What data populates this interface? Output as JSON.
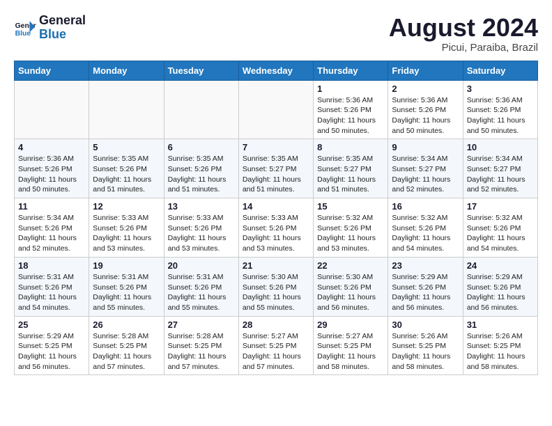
{
  "logo": {
    "line1": "General",
    "line2": "Blue"
  },
  "title": "August 2024",
  "subtitle": "Picui, Paraiba, Brazil",
  "weekdays": [
    "Sunday",
    "Monday",
    "Tuesday",
    "Wednesday",
    "Thursday",
    "Friday",
    "Saturday"
  ],
  "weeks": [
    [
      {
        "day": "",
        "info": ""
      },
      {
        "day": "",
        "info": ""
      },
      {
        "day": "",
        "info": ""
      },
      {
        "day": "",
        "info": ""
      },
      {
        "day": "1",
        "info": "Sunrise: 5:36 AM\nSunset: 5:26 PM\nDaylight: 11 hours\nand 50 minutes."
      },
      {
        "day": "2",
        "info": "Sunrise: 5:36 AM\nSunset: 5:26 PM\nDaylight: 11 hours\nand 50 minutes."
      },
      {
        "day": "3",
        "info": "Sunrise: 5:36 AM\nSunset: 5:26 PM\nDaylight: 11 hours\nand 50 minutes."
      }
    ],
    [
      {
        "day": "4",
        "info": "Sunrise: 5:36 AM\nSunset: 5:26 PM\nDaylight: 11 hours\nand 50 minutes."
      },
      {
        "day": "5",
        "info": "Sunrise: 5:35 AM\nSunset: 5:26 PM\nDaylight: 11 hours\nand 51 minutes."
      },
      {
        "day": "6",
        "info": "Sunrise: 5:35 AM\nSunset: 5:26 PM\nDaylight: 11 hours\nand 51 minutes."
      },
      {
        "day": "7",
        "info": "Sunrise: 5:35 AM\nSunset: 5:27 PM\nDaylight: 11 hours\nand 51 minutes."
      },
      {
        "day": "8",
        "info": "Sunrise: 5:35 AM\nSunset: 5:27 PM\nDaylight: 11 hours\nand 51 minutes."
      },
      {
        "day": "9",
        "info": "Sunrise: 5:34 AM\nSunset: 5:27 PM\nDaylight: 11 hours\nand 52 minutes."
      },
      {
        "day": "10",
        "info": "Sunrise: 5:34 AM\nSunset: 5:27 PM\nDaylight: 11 hours\nand 52 minutes."
      }
    ],
    [
      {
        "day": "11",
        "info": "Sunrise: 5:34 AM\nSunset: 5:26 PM\nDaylight: 11 hours\nand 52 minutes."
      },
      {
        "day": "12",
        "info": "Sunrise: 5:33 AM\nSunset: 5:26 PM\nDaylight: 11 hours\nand 53 minutes."
      },
      {
        "day": "13",
        "info": "Sunrise: 5:33 AM\nSunset: 5:26 PM\nDaylight: 11 hours\nand 53 minutes."
      },
      {
        "day": "14",
        "info": "Sunrise: 5:33 AM\nSunset: 5:26 PM\nDaylight: 11 hours\nand 53 minutes."
      },
      {
        "day": "15",
        "info": "Sunrise: 5:32 AM\nSunset: 5:26 PM\nDaylight: 11 hours\nand 53 minutes."
      },
      {
        "day": "16",
        "info": "Sunrise: 5:32 AM\nSunset: 5:26 PM\nDaylight: 11 hours\nand 54 minutes."
      },
      {
        "day": "17",
        "info": "Sunrise: 5:32 AM\nSunset: 5:26 PM\nDaylight: 11 hours\nand 54 minutes."
      }
    ],
    [
      {
        "day": "18",
        "info": "Sunrise: 5:31 AM\nSunset: 5:26 PM\nDaylight: 11 hours\nand 54 minutes."
      },
      {
        "day": "19",
        "info": "Sunrise: 5:31 AM\nSunset: 5:26 PM\nDaylight: 11 hours\nand 55 minutes."
      },
      {
        "day": "20",
        "info": "Sunrise: 5:31 AM\nSunset: 5:26 PM\nDaylight: 11 hours\nand 55 minutes."
      },
      {
        "day": "21",
        "info": "Sunrise: 5:30 AM\nSunset: 5:26 PM\nDaylight: 11 hours\nand 55 minutes."
      },
      {
        "day": "22",
        "info": "Sunrise: 5:30 AM\nSunset: 5:26 PM\nDaylight: 11 hours\nand 56 minutes."
      },
      {
        "day": "23",
        "info": "Sunrise: 5:29 AM\nSunset: 5:26 PM\nDaylight: 11 hours\nand 56 minutes."
      },
      {
        "day": "24",
        "info": "Sunrise: 5:29 AM\nSunset: 5:26 PM\nDaylight: 11 hours\nand 56 minutes."
      }
    ],
    [
      {
        "day": "25",
        "info": "Sunrise: 5:29 AM\nSunset: 5:25 PM\nDaylight: 11 hours\nand 56 minutes."
      },
      {
        "day": "26",
        "info": "Sunrise: 5:28 AM\nSunset: 5:25 PM\nDaylight: 11 hours\nand 57 minutes."
      },
      {
        "day": "27",
        "info": "Sunrise: 5:28 AM\nSunset: 5:25 PM\nDaylight: 11 hours\nand 57 minutes."
      },
      {
        "day": "28",
        "info": "Sunrise: 5:27 AM\nSunset: 5:25 PM\nDaylight: 11 hours\nand 57 minutes."
      },
      {
        "day": "29",
        "info": "Sunrise: 5:27 AM\nSunset: 5:25 PM\nDaylight: 11 hours\nand 58 minutes."
      },
      {
        "day": "30",
        "info": "Sunrise: 5:26 AM\nSunset: 5:25 PM\nDaylight: 11 hours\nand 58 minutes."
      },
      {
        "day": "31",
        "info": "Sunrise: 5:26 AM\nSunset: 5:25 PM\nDaylight: 11 hours\nand 58 minutes."
      }
    ]
  ]
}
